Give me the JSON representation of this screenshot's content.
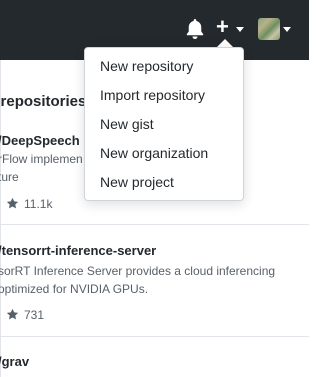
{
  "header": {
    "bell_icon": "bell-icon",
    "plus_icon": "plus-icon",
    "plus_symbol": "+",
    "avatar_alt": "avatar"
  },
  "dropdown": {
    "items": [
      {
        "label": "New repository"
      },
      {
        "label": "Import repository"
      },
      {
        "label": "New gist"
      },
      {
        "label": "New organization"
      },
      {
        "label": "New project"
      }
    ]
  },
  "section_title": "e repositories",
  "repos": [
    {
      "name": "/DeepSpeech",
      "description_lines": [
        "rFlow implemen",
        "ture"
      ],
      "stars": "11.1k"
    },
    {
      "name": "/tensorrt-inference-server",
      "description_lines": [
        "sorRT Inference Server provides a cloud inferencing",
        " optimized for NVIDIA GPUs."
      ],
      "stars": "731"
    },
    {
      "name": "/grav",
      "description_lines": [],
      "stars": ""
    }
  ],
  "colors": {
    "header_bg": "#24292e",
    "text_primary": "#24292e",
    "text_secondary": "#586069",
    "border": "#e1e4e8"
  }
}
